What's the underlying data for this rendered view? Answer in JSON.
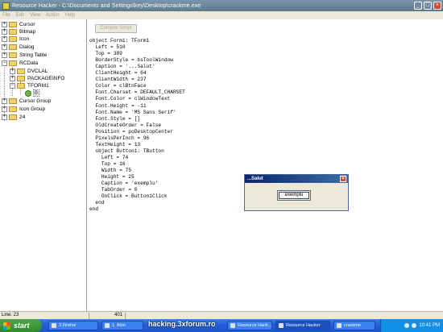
{
  "window": {
    "title": "Resource Hacker  -  C:\\Documents and Settings\\key\\Desktop\\crackme.exe",
    "min_label": "_",
    "max_label": "□",
    "close_label": "×"
  },
  "menu": [
    "File",
    "Edit",
    "View",
    "Action",
    "Help"
  ],
  "tree": {
    "items": [
      {
        "label": "Cursor",
        "expander": "+"
      },
      {
        "label": "Bitmap",
        "expander": "+"
      },
      {
        "label": "Icon",
        "expander": "+"
      },
      {
        "label": "Dialog",
        "expander": "+"
      },
      {
        "label": "String Table",
        "expander": "+"
      },
      {
        "label": "RCData",
        "expander": "−"
      },
      {
        "label": "DVCLAL",
        "expander": "+"
      },
      {
        "label": "PACKAGEINFO",
        "expander": "+"
      },
      {
        "label": "TFORM1",
        "expander": "−"
      },
      {
        "label": "0",
        "expander": ""
      },
      {
        "label": "Cursor Group",
        "expander": "+"
      },
      {
        "label": "Icon Group",
        "expander": "+"
      },
      {
        "label": "24",
        "expander": "+"
      }
    ]
  },
  "toolbar": {
    "compile_label": "Compile Script"
  },
  "code": {
    "lines": [
      "object Form1: TForm1",
      "  Left = 510",
      "  Top = 389",
      "  BorderStyle = bsToolWindow",
      "  Caption = '...Salut'",
      "  ClientHeight = 64",
      "  ClientWidth = 237",
      "  Color = clBtnFace",
      "  Font.Charset = DEFAULT_CHARSET",
      "  Font.Color = clWindowText",
      "  Font.Height = -11",
      "  Font.Name = 'MS Sans Serif'",
      "  Font.Style = []",
      "  OldCreateOrder = False",
      "  Position = poDesktopCenter",
      "  PixelsPerInch = 96",
      "  TextHeight = 13",
      "  object Button1: TButton",
      "    Left = 74",
      "    Top = 16",
      "    Width = 75",
      "    Height = 25",
      "    Caption = 'exemplu'",
      "    TabOrder = 0",
      "    OnClick = Button1Click",
      "  end",
      "end"
    ]
  },
  "dialog": {
    "title": "...Salut",
    "button_label": "exemplu",
    "close_label": "×"
  },
  "status": {
    "line": "Line: 23",
    "num": "401"
  },
  "taskbar": {
    "start_label": "start",
    "tasks": [
      "3 Firefox",
      "1. Alon",
      "Resource Hack...",
      "Resource Hacker",
      "crackme"
    ],
    "watermark": "hacking.3xforum.ro",
    "clock": "10:41 PM"
  }
}
